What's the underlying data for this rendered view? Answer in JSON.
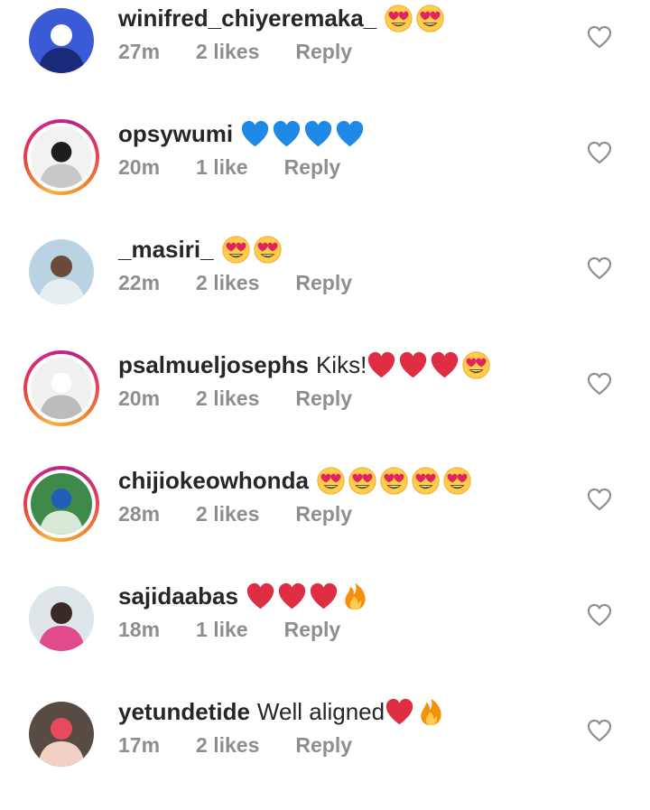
{
  "comments": [
    {
      "username": "winifred_chiyeremaka_",
      "text": "",
      "emojis": [
        "heart-eyes",
        "heart-eyes"
      ],
      "time": "27m",
      "likes": "2 likes",
      "reply": "Reply",
      "story_ring": false,
      "avatar_colors": [
        "#3b5bd6",
        "#ffffff",
        "#1c2a7a"
      ]
    },
    {
      "username": "opsywumi",
      "text": "",
      "emojis": [
        "blue-heart",
        "blue-heart",
        "blue-heart",
        "blue-heart"
      ],
      "time": "20m",
      "likes": "1 like",
      "reply": "Reply",
      "story_ring": true,
      "avatar_colors": [
        "#f2f2f2",
        "#1d1d1d",
        "#c8c8c8"
      ]
    },
    {
      "username": "_masiri_",
      "text": "",
      "emojis": [
        "heart-eyes",
        "heart-eyes"
      ],
      "time": "22m",
      "likes": "2 likes",
      "reply": "Reply",
      "story_ring": false,
      "avatar_colors": [
        "#b9d3e3",
        "#6b4a3a",
        "#e7eef2"
      ]
    },
    {
      "username": "psalmueljosephs",
      "text": "Kiks!",
      "emojis": [
        "red-heart",
        "red-heart",
        "red-heart",
        "heart-eyes"
      ],
      "time": "20m",
      "likes": "2 likes",
      "reply": "Reply",
      "story_ring": true,
      "avatar_colors": [
        "#f1f1f1",
        "#ffffff",
        "#bcbcbc"
      ]
    },
    {
      "username": "chijiokeowhonda",
      "text": "",
      "emojis": [
        "heart-eyes",
        "heart-eyes",
        "heart-eyes",
        "heart-eyes",
        "heart-eyes"
      ],
      "time": "28m",
      "likes": "2 likes",
      "reply": "Reply",
      "story_ring": true,
      "avatar_colors": [
        "#3f8a4a",
        "#1f5fb8",
        "#d9e7d6"
      ]
    },
    {
      "username": "sajidaabas",
      "text": "",
      "emojis": [
        "red-heart",
        "red-heart",
        "red-heart",
        "fire"
      ],
      "time": "18m",
      "likes": "1 like",
      "reply": "Reply",
      "story_ring": false,
      "avatar_colors": [
        "#dfe6ea",
        "#3a2a25",
        "#e24b8b"
      ]
    },
    {
      "username": "yetundetide",
      "text": "Well aligned",
      "emojis": [
        "red-heart",
        "fire"
      ],
      "time": "17m",
      "likes": "2 likes",
      "reply": "Reply",
      "story_ring": false,
      "avatar_colors": [
        "#5a4a44",
        "#e84a5f",
        "#f2d2c4"
      ]
    }
  ],
  "colors": {
    "meta_gray": "#8e8e8e",
    "text": "#262626",
    "heart_outline": "#8e8e8e"
  }
}
